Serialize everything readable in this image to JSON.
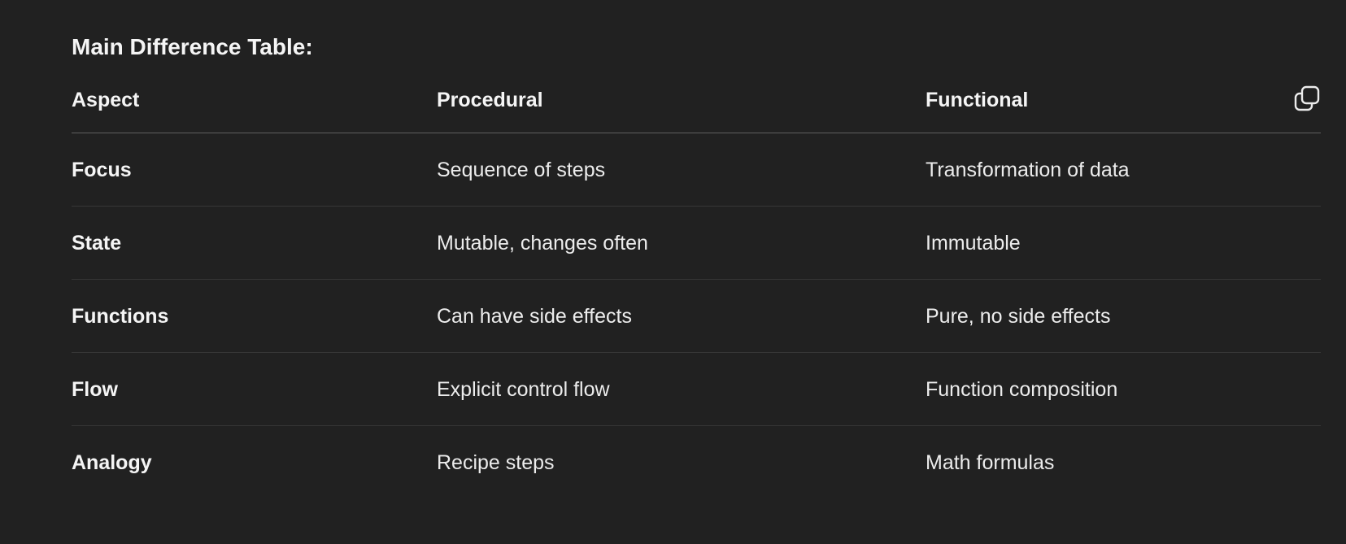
{
  "heading": "Main Difference Table:",
  "table": {
    "headers": [
      "Aspect",
      "Procedural",
      "Functional"
    ],
    "rows": [
      [
        "Focus",
        "Sequence of steps",
        "Transformation of data"
      ],
      [
        "State",
        "Mutable, changes often",
        "Immutable"
      ],
      [
        "Functions",
        "Can have side effects",
        "Pure, no side effects"
      ],
      [
        "Flow",
        "Explicit control flow",
        "Function composition"
      ],
      [
        "Analogy",
        "Recipe steps",
        "Math formulas"
      ]
    ]
  },
  "icons": {
    "copy": "copy-icon"
  }
}
